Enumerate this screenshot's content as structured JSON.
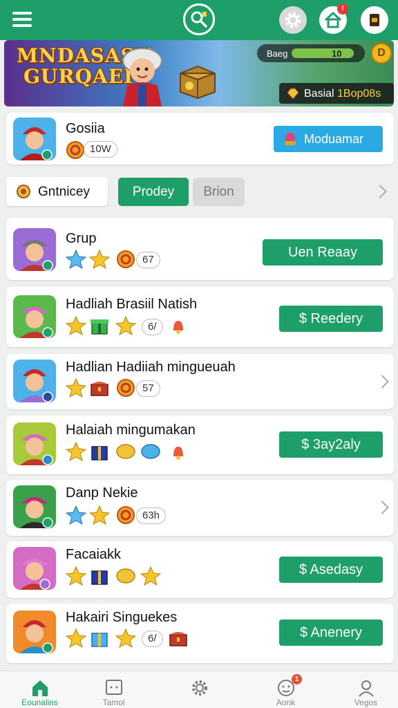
{
  "colors": {
    "accent": "#1e9e68",
    "banner_blue_button": "#2aa9e2",
    "badge_red": "#e53935",
    "inactive_tab": "#d9d9d9"
  },
  "header": {
    "icons": [
      "hamburger-icon",
      "search-icon",
      "gear-icon",
      "home-icon",
      "wallet-icon"
    ],
    "home_badge": "!"
  },
  "banner": {
    "title_line1": "MNDASASK",
    "title_line2": "GURQAEI",
    "level_label": "Baeg",
    "level_value": "10",
    "coin_label": "D",
    "status_prefix": "Basial",
    "status_value": "1Bop08s"
  },
  "featured": {
    "title": "Gosiia",
    "count": "10W",
    "button_label": "Moduamar"
  },
  "filter": {
    "label": "Gntnicey",
    "tabs": [
      "Prodey",
      "Brion"
    ]
  },
  "list": [
    {
      "title": "Grup",
      "count": "67",
      "action": "Uen Reaay",
      "action_type": "button"
    },
    {
      "title": "Hadliah Brasiil Natish",
      "count": "6/",
      "action": "$ Reedery",
      "action_type": "button"
    },
    {
      "title": "Hadlian Hadiiah mingueuah",
      "count": "57",
      "action": "",
      "action_type": "chevron"
    },
    {
      "title": "Halaiah mingumakan",
      "count": "",
      "action": "$ 3ay2aly",
      "action_type": "button"
    },
    {
      "title": "Danp Nekie",
      "count": "63h",
      "action": "",
      "action_type": "chevron"
    },
    {
      "title": "Facaiakk",
      "count": "",
      "action": "$ Asedasy",
      "action_type": "button"
    },
    {
      "title": "Hakairi Singuekes",
      "count": "6/",
      "action": "$ Anenery",
      "action_type": "button"
    }
  ],
  "bottom_nav": [
    {
      "label": "Eounalins",
      "icon": "home-icon",
      "active": true
    },
    {
      "label": "Tamol",
      "icon": "screen-icon",
      "active": false
    },
    {
      "label": "",
      "icon": "gear-icon",
      "active": false
    },
    {
      "label": "Aonk",
      "icon": "smiley-icon",
      "active": false,
      "badge": "1"
    },
    {
      "label": "Vegos",
      "icon": "profile-icon",
      "active": false
    }
  ]
}
